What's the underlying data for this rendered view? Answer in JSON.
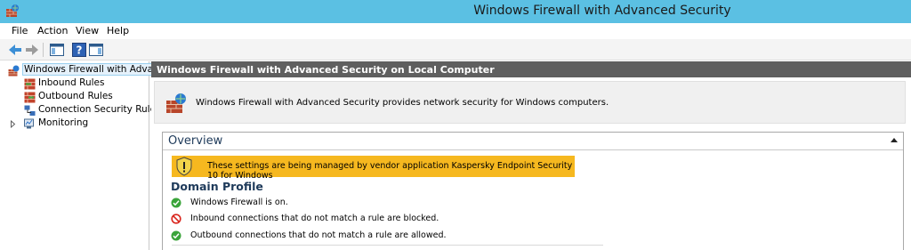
{
  "window": {
    "title": "Windows Firewall with Advanced Security",
    "app_icon": "firewall-brick-icon"
  },
  "menu": {
    "items": [
      "File",
      "Action",
      "View",
      "Help"
    ]
  },
  "toolbar": {
    "icons": [
      "back-arrow-icon",
      "forward-arrow-icon",
      "show-hide-console-tree-icon",
      "help-icon",
      "show-hide-action-pane-icon"
    ]
  },
  "tree": {
    "root": "Windows Firewall with Advance",
    "items": [
      "Inbound Rules",
      "Outbound Rules",
      "Connection Security Rules",
      "Monitoring"
    ]
  },
  "pane": {
    "header": "Windows Firewall with Advanced Security on Local Computer",
    "intro": "Windows Firewall with Advanced Security provides network security for Windows computers."
  },
  "overview": {
    "title": "Overview",
    "banner": "These settings are being managed by vendor application Kaspersky Endpoint Security 10 for Windows",
    "profile_title": "Domain Profile",
    "statuses": [
      {
        "text": "Windows Firewall is on.",
        "icon": "green-check-icon"
      },
      {
        "text": "Inbound connections that do not match a rule are blocked.",
        "icon": "red-block-icon"
      },
      {
        "text": "Outbound connections that do not match a rule are allowed.",
        "icon": "green-check-icon"
      }
    ]
  },
  "colors": {
    "titlebar": "#5bc0e3",
    "pane_header": "#5f5f5f",
    "banner": "#f6b81f",
    "ok": "#3aa43a",
    "blocked": "#d9241c"
  }
}
